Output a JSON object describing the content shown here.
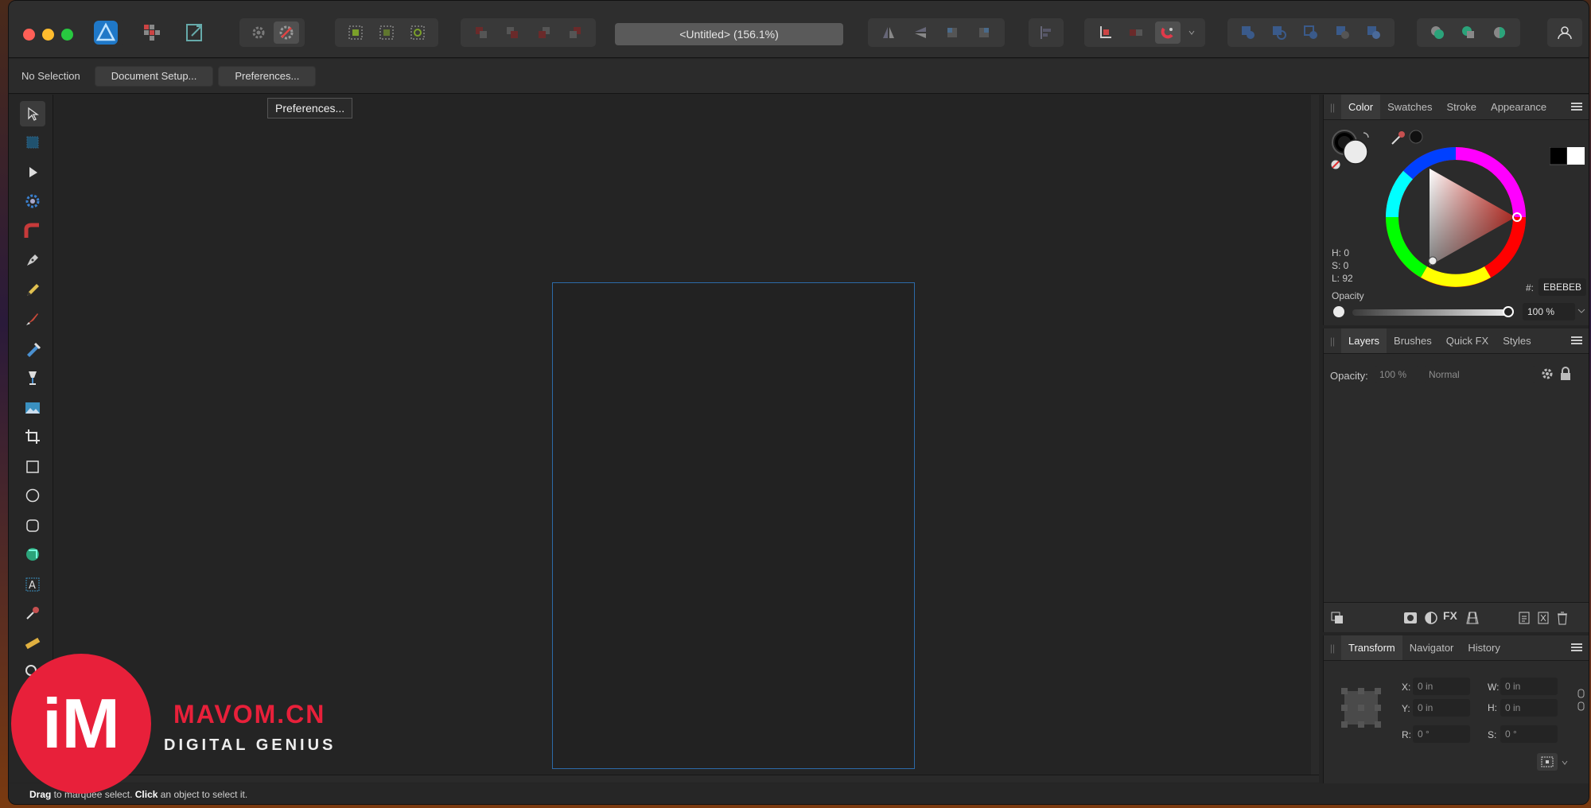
{
  "window": {
    "document_title": "<Untitled> (156.1%)"
  },
  "context_toolbar": {
    "selection_label": "No Selection",
    "document_setup_label": "Document Setup...",
    "preferences_label": "Preferences..."
  },
  "tooltip": {
    "text": "Preferences..."
  },
  "toolbar_tools": [
    "move-tool",
    "artboard-tool",
    "node-tool",
    "point-transform-tool",
    "corner-tool",
    "pen-tool",
    "pencil-tool",
    "vector-brush-tool",
    "fill-tool",
    "transparency-tool",
    "place-image-tool",
    "crop-tool",
    "rectangle-tool",
    "ellipse-tool",
    "rounded-rectangle-tool",
    "shape-tool",
    "artistic-text-tool",
    "color-picker-tool",
    "measure-tool",
    "zoom-tool"
  ],
  "color_panel": {
    "tabs": [
      "Color",
      "Swatches",
      "Stroke",
      "Appearance"
    ],
    "h_label": "H: 0",
    "s_label": "S: 0",
    "l_label": "L: 92",
    "hex_label": "#:",
    "hex_value": "EBEBEB",
    "opacity_label": "Opacity",
    "opacity_value": "100 %",
    "accent": "#e0342a"
  },
  "layers_panel": {
    "tabs": [
      "Layers",
      "Brushes",
      "Quick FX",
      "Styles"
    ],
    "opacity_label": "Opacity:",
    "opacity_value": "100 %",
    "blend_mode": "Normal"
  },
  "transform_panel": {
    "tabs": [
      "Transform",
      "Navigator",
      "History"
    ],
    "x_label": "X:",
    "x_value": "0 in",
    "y_label": "Y:",
    "y_value": "0 in",
    "w_label": "W:",
    "w_value": "0 in",
    "h_label": "H:",
    "h_value": "0 in",
    "r_label": "R:",
    "r_value": "0 °",
    "s_label": "S:",
    "s_value": "0 °"
  },
  "status": {
    "drag": "Drag",
    "text1": " to marquee select. ",
    "click": "Click",
    "text2": " an object to select it."
  },
  "watermark": {
    "logo": "iM",
    "name": "MAVOM.CN",
    "tagline": "DIGITAL GENIUS"
  }
}
